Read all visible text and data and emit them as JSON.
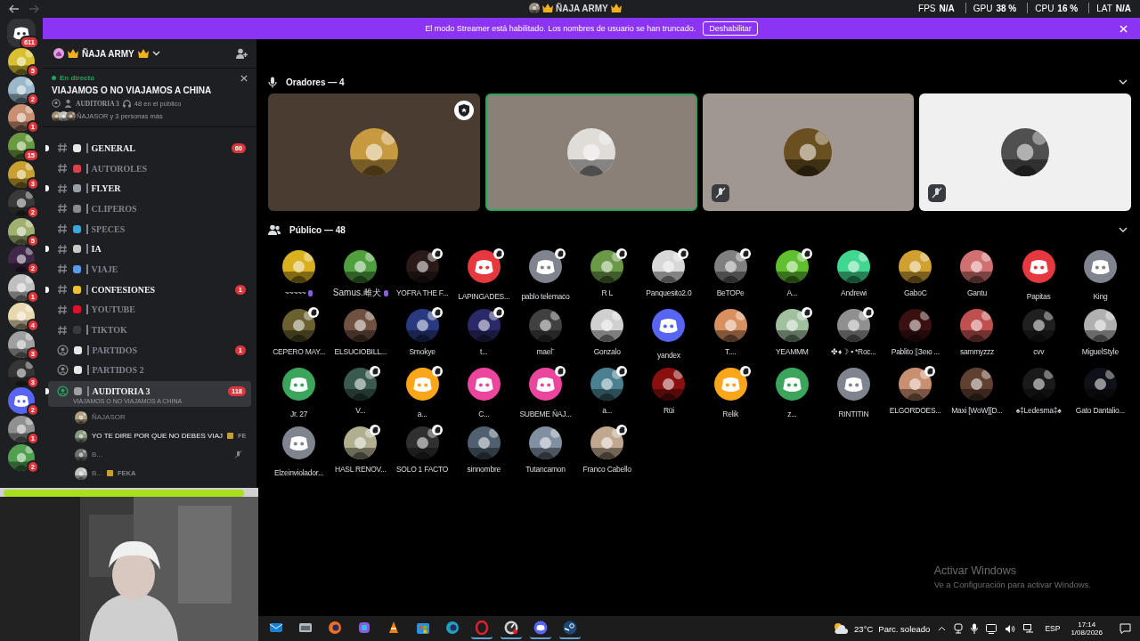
{
  "titlebar": {
    "title": "ÑAJA ARMY"
  },
  "overlay_stats": [
    {
      "label": "FPS",
      "value": "N/A"
    },
    {
      "label": "GPU",
      "value": "38 %"
    },
    {
      "label": "CPU",
      "value": "16 %"
    },
    {
      "label": "LAT",
      "value": "N/A"
    }
  ],
  "banner": {
    "text": "El modo Streamer está habilitado. Los nombres de usuario se han truncado.",
    "button": "Deshabilitar"
  },
  "servers": [
    {
      "kind": "home",
      "color": "#313338",
      "badge": "611"
    },
    {
      "kind": "picture",
      "color": "#d8c030",
      "badge": "5"
    },
    {
      "kind": "picture",
      "color": "#9ab8c8",
      "badge": "2"
    },
    {
      "kind": "picture",
      "color": "#c89070",
      "badge": "1"
    },
    {
      "kind": "picture",
      "color": "#6a9a40",
      "badge": "15"
    },
    {
      "kind": "picture",
      "color": "#c8a030",
      "badge": "3"
    },
    {
      "kind": "picture",
      "color": "#3a3a3a",
      "badge": "2"
    },
    {
      "kind": "picture",
      "color": "#a0b070",
      "badge": "5"
    },
    {
      "kind": "picture",
      "color": "#402848",
      "badge": "2"
    },
    {
      "kind": "picture",
      "color": "#c0c0c0",
      "badge": "1"
    },
    {
      "kind": "picture",
      "color": "#e8d8b0",
      "badge": "4"
    },
    {
      "kind": "picture",
      "color": "#a0a0a0",
      "badge": "3"
    },
    {
      "kind": "picture",
      "color": "#353535",
      "badge": "3"
    },
    {
      "kind": "logo",
      "color": "#5865f2",
      "badge": "2"
    },
    {
      "kind": "picture",
      "color": "#909090",
      "badge": "1"
    },
    {
      "kind": "picture",
      "color": "#50a050",
      "badge": "2"
    }
  ],
  "server_header": {
    "name": "ÑAJA ARMY"
  },
  "live": {
    "status": "En directo",
    "title": "VIAJAMOS O NO VIAJAMOS A CHINA",
    "channel": "AUDITORIA 3",
    "audience": "48 en el público",
    "participants": "ÑAJASOR y 3 personas más"
  },
  "channels": [
    {
      "kind": "text",
      "name": "GENERAL",
      "unread": true,
      "color": "#e8e8e8",
      "badge": "60",
      "selected": false
    },
    {
      "kind": "text",
      "name": "AUTOROLES",
      "unread": false,
      "color": "#e0404a",
      "selected": false
    },
    {
      "kind": "text",
      "name": "FLYER",
      "unread": true,
      "color": "#9aa0aa",
      "selected": false
    },
    {
      "kind": "text",
      "name": "CLIPEROS",
      "unread": false,
      "color": "#8a8a8a",
      "selected": false
    },
    {
      "kind": "text",
      "name": "SPECES",
      "unread": false,
      "color": "#3aa8d8",
      "selected": false
    },
    {
      "kind": "text",
      "name": "IA",
      "unread": true,
      "color": "#c8c8c8",
      "selected": false
    },
    {
      "kind": "text",
      "name": "VIAJE",
      "unread": false,
      "color": "#5a9ae8",
      "selected": false
    },
    {
      "kind": "text",
      "name": "CONFESIONES",
      "unread": true,
      "color": "#f0c030",
      "badge": "1",
      "selected": false
    },
    {
      "kind": "text",
      "name": "YOUTUBE",
      "unread": false,
      "color": "#e0102a",
      "selected": false
    },
    {
      "kind": "text",
      "name": "TIKTOK",
      "unread": false,
      "color": "#3a3b40",
      "selected": false
    },
    {
      "kind": "stage",
      "name": "PARTIDOS",
      "unread": false,
      "color": "#e8e8e8",
      "badge": "1",
      "selected": false
    },
    {
      "kind": "stage",
      "name": "PARTIDOS 2",
      "unread": false,
      "color": "#e8e8e8",
      "selected": false
    },
    {
      "kind": "stage",
      "name": "AUDITORIA 3",
      "unread": true,
      "color": "#a0a0a0",
      "badge": "118",
      "selected": true,
      "topic": "VIAJAMOS O NO VIAJAMOS A CHINA",
      "members": [
        {
          "name": "ÑAJASOR",
          "active": false,
          "color": "#b0a080",
          "muted": false
        },
        {
          "name": "YO TE DIRE POR QUE NO DEBES VIAJ",
          "active": true,
          "color": "#8a9a80",
          "muted": false,
          "tag": "FE"
        },
        {
          "name": "B...",
          "active": false,
          "color": "#707070",
          "muted": true
        },
        {
          "name": "B...",
          "active": false,
          "color": "#c0c0c0",
          "muted": false,
          "tag": "FEKA"
        }
      ]
    }
  ],
  "speakers_header": "Oradores — 4",
  "speakers": [
    {
      "color": "#4a3c30",
      "speaking": false,
      "muted": false,
      "moderator": true
    },
    {
      "color": "#8a8078",
      "speaking": true,
      "muted": false,
      "moderator": false
    },
    {
      "color": "#a09890",
      "speaking": false,
      "muted": true,
      "moderator": false
    },
    {
      "color": "#f0f0f0",
      "speaking": false,
      "muted": true,
      "moderator": false
    }
  ],
  "audience_header": "Público — 48",
  "audience": [
    {
      "name": "~~~~~",
      "kind": "picture",
      "color": "#d8b020",
      "badge": false,
      "emblem": true
    },
    {
      "name": "Samus.雌犬",
      "kind": "picture",
      "color": "#50a040",
      "badge": false,
      "emblem": true
    },
    {
      "name": "YOFRA THE F...",
      "kind": "picture",
      "color": "#2a1a1a",
      "badge": true,
      "emblem": false
    },
    {
      "name": "LAPINGADES...",
      "kind": "logo",
      "color": "#e5383f",
      "badge": true,
      "emblem": false
    },
    {
      "name": "pablo telemaco",
      "kind": "logo",
      "color": "#80848e",
      "badge": true,
      "emblem": false
    },
    {
      "name": "R L",
      "kind": "picture",
      "color": "#6a9a48",
      "badge": true,
      "emblem": false
    },
    {
      "name": "Panquesito2.0",
      "kind": "picture",
      "color": "#d8d8d8",
      "badge": true,
      "emblem": false
    },
    {
      "name": "BeTOPe",
      "kind": "picture",
      "color": "#808080",
      "badge": true,
      "emblem": false
    },
    {
      "name": "A...",
      "kind": "picture",
      "color": "#60c030",
      "badge": true,
      "emblem": false
    },
    {
      "name": "Andrewi",
      "kind": "picture",
      "color": "#40d890",
      "badge": false,
      "emblem": false
    },
    {
      "name": "GaboC",
      "kind": "picture",
      "color": "#d0a030",
      "badge": false,
      "emblem": false
    },
    {
      "name": "Gantu",
      "kind": "picture",
      "color": "#d07070",
      "badge": false,
      "emblem": false
    },
    {
      "name": "Papitas",
      "kind": "logo",
      "color": "#e5383f",
      "badge": false,
      "emblem": false
    },
    {
      "name": "King",
      "kind": "logo",
      "color": "#80848e",
      "badge": false,
      "emblem": false
    },
    {
      "name": "CEPERO MAY...",
      "kind": "picture",
      "color": "#6a6030",
      "badge": true,
      "emblem": false
    },
    {
      "name": "ELSUCIOBILL...",
      "kind": "picture",
      "color": "#705040",
      "badge": false,
      "emblem": false
    },
    {
      "name": "Smokye",
      "kind": "picture",
      "color": "#2a3a80",
      "badge": true,
      "emblem": false
    },
    {
      "name": "t...",
      "kind": "picture",
      "color": "#2a2a6a",
      "badge": true,
      "emblem": false
    },
    {
      "name": "mael¨",
      "kind": "picture",
      "color": "#404040",
      "badge": false,
      "emblem": false
    },
    {
      "name": "Gonzalo",
      "kind": "picture",
      "color": "#d0d0d0",
      "badge": false,
      "emblem": false
    },
    {
      "name": "yandex",
      "kind": "logo",
      "color": "#5865f2",
      "badge": false,
      "emblem": false
    },
    {
      "name": "T....",
      "kind": "picture",
      "color": "#d89060",
      "badge": false,
      "emblem": false
    },
    {
      "name": "YEAMMM",
      "kind": "picture",
      "color": "#a0c0a0",
      "badge": true,
      "emblem": false
    },
    {
      "name": "✤♦☽ ▪ *Roc...",
      "kind": "picture",
      "color": "#909090",
      "badge": true,
      "emblem": false
    },
    {
      "name": "Pablito ⟦Зею ...",
      "kind": "picture",
      "color": "#3a1010",
      "badge": false,
      "emblem": false
    },
    {
      "name": "sammyzzz",
      "kind": "picture",
      "color": "#c05050",
      "badge": false,
      "emblem": false
    },
    {
      "name": "cvv",
      "kind": "picture",
      "color": "#202020",
      "badge": false,
      "emblem": false
    },
    {
      "name": "MiguelStyle",
      "kind": "picture",
      "color": "#b0b0b0",
      "badge": false,
      "emblem": false
    },
    {
      "name": "Jr. 27",
      "kind": "logo",
      "color": "#3ba55c",
      "badge": false,
      "emblem": false
    },
    {
      "name": "V...",
      "kind": "picture",
      "color": "#3a5a50",
      "badge": true,
      "emblem": false
    },
    {
      "name": "a...",
      "kind": "logo",
      "color": "#faa61a",
      "badge": true,
      "emblem": false
    },
    {
      "name": "C...",
      "kind": "logo",
      "color": "#eb459e",
      "badge": false,
      "emblem": false
    },
    {
      "name": "SUBEME ÑAJ...",
      "kind": "logo",
      "color": "#eb459e",
      "badge": true,
      "emblem": false
    },
    {
      "name": "a...",
      "kind": "picture",
      "color": "#4a8090",
      "badge": true,
      "emblem": false
    },
    {
      "name": "Rüi",
      "kind": "picture",
      "color": "#8a1010",
      "badge": false,
      "emblem": false
    },
    {
      "name": "Relik",
      "kind": "logo",
      "color": "#faa61a",
      "badge": true,
      "emblem": false
    },
    {
      "name": "z...",
      "kind": "logo",
      "color": "#3ba55c",
      "badge": false,
      "emblem": false
    },
    {
      "name": "RINTITIN",
      "kind": "logo",
      "color": "#80848e",
      "badge": false,
      "emblem": false
    },
    {
      "name": "ELGORDOES...",
      "kind": "picture",
      "color": "#c89070",
      "badge": true,
      "emblem": false
    },
    {
      "name": "Maxi [WoW][D...",
      "kind": "picture",
      "color": "#604030",
      "badge": false,
      "emblem": false
    },
    {
      "name": "♠‡Ledesma‡♠",
      "kind": "picture",
      "color": "#1a1a1a",
      "badge": false,
      "emblem": false
    },
    {
      "name": "Gato Dantalio...",
      "kind": "picture",
      "color": "#101018",
      "badge": false,
      "emblem": false
    },
    {
      "name": "Elzeinviolador...",
      "kind": "logo",
      "color": "#80848e",
      "badge": false,
      "emblem": false
    },
    {
      "name": "HASL RENOV...",
      "kind": "picture",
      "color": "#b0b090",
      "badge": true,
      "emblem": false
    },
    {
      "name": "SOLO 1 FACTO",
      "kind": "picture",
      "color": "#303030",
      "badge": true,
      "emblem": false
    },
    {
      "name": "sinnombre",
      "kind": "picture",
      "color": "#506070",
      "badge": false,
      "emblem": false
    },
    {
      "name": "Tutancamon",
      "kind": "picture",
      "color": "#8090a0",
      "badge": false,
      "emblem": false
    },
    {
      "name": "Franco Cabello",
      "kind": "picture",
      "color": "#c0a890",
      "badge": true,
      "emblem": false
    }
  ],
  "watermark": {
    "title": "Activar Windows",
    "text": "Ve a Configuración para activar Windows."
  },
  "taskbar": {
    "apps": [
      {
        "kind": "mail",
        "color": "#1a7fd8",
        "active": false
      },
      {
        "kind": "window",
        "color": "#b0b8c0",
        "active": false
      },
      {
        "kind": "globe",
        "color": "#f07020",
        "active": false
      },
      {
        "kind": "tile",
        "color": "#8a5ae0",
        "active": false
      },
      {
        "kind": "cone",
        "color": "#f08010",
        "active": false
      },
      {
        "kind": "bag",
        "color": "#2a90e0",
        "active": false
      },
      {
        "kind": "globe",
        "color": "#20a0c0",
        "active": false
      },
      {
        "kind": "ring",
        "color": "#e0202a",
        "active": true
      },
      {
        "kind": "dial",
        "color": "#d0d0d0",
        "active": true
      },
      {
        "kind": "chat",
        "color": "#5865f2",
        "active": true
      },
      {
        "kind": "steam",
        "color": "#1b4a7a",
        "active": true
      }
    ],
    "weather_temp": "23°C",
    "weather_text": "Parc. soleado",
    "lang": "ESP",
    "time": "17:14",
    "date": "1/08/2026"
  }
}
